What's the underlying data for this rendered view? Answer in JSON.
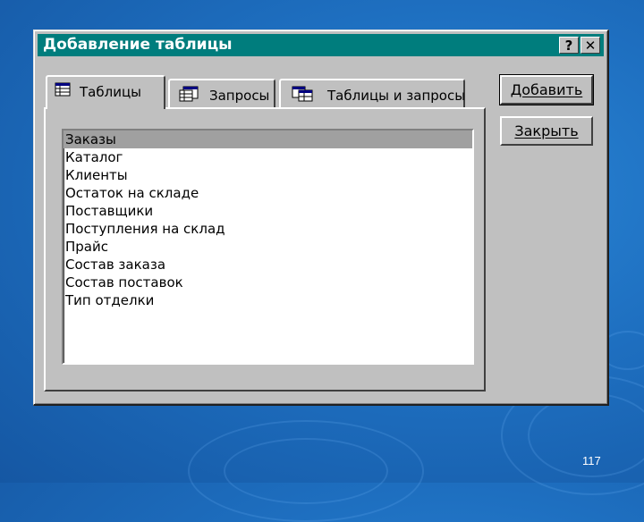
{
  "window": {
    "title": "Добавление таблицы",
    "help_label": "?",
    "close_label": "✕"
  },
  "tabs": [
    {
      "label": "Таблицы",
      "icon": "table-icon",
      "active": true
    },
    {
      "label": "Запросы",
      "icon": "query-icon",
      "active": false
    },
    {
      "label": "Таблицы и запросы",
      "icon": "tables-and-queries-icon",
      "active": false
    }
  ],
  "list": {
    "items": [
      "Заказы",
      "Каталог",
      "Клиенты",
      "Остаток на складе",
      "Поставщики",
      "Поступления на склад",
      "Прайс",
      "Состав заказа",
      "Состав поставок",
      "Тип отделки"
    ],
    "selected": "Заказы"
  },
  "buttons": {
    "add_label": "Добавить",
    "close_label": "Закрыть"
  },
  "slide": {
    "page_number": "117"
  },
  "colors": {
    "title_bar": "#007d7d",
    "dialog_face": "#c0c0c0",
    "selection": "#a0a0a0"
  }
}
